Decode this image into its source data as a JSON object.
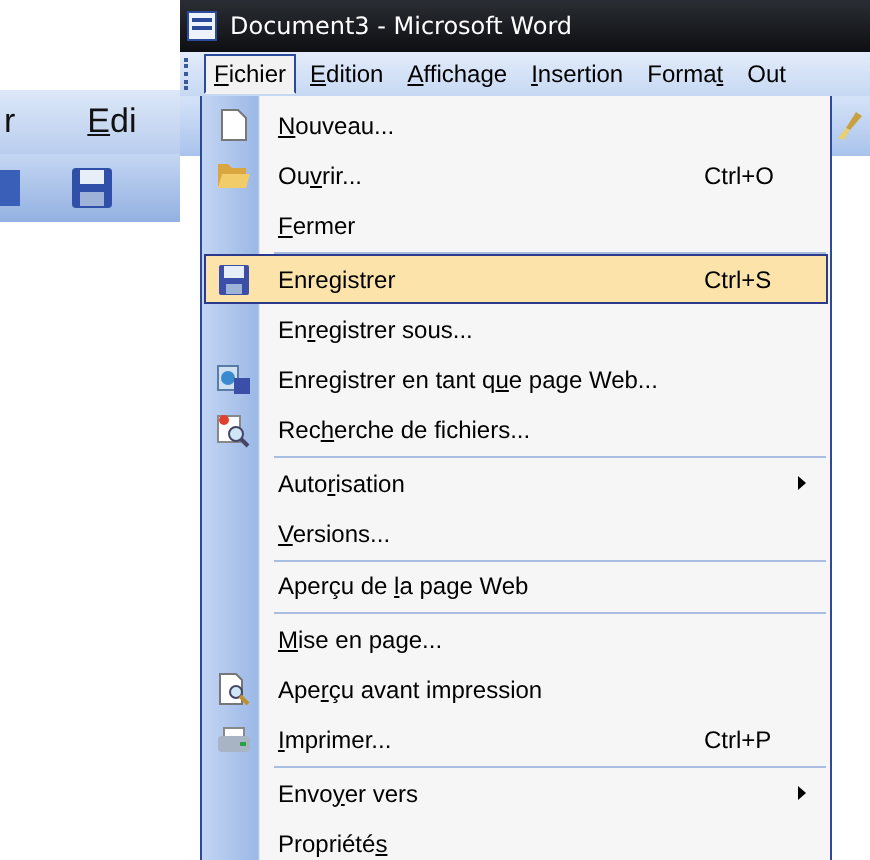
{
  "background_window": {
    "menu_items": [
      {
        "parts": [
          {
            "text": "r",
            "underline": false
          }
        ]
      },
      {
        "parts": [
          {
            "text": "E",
            "underline": true
          },
          {
            "text": "di",
            "underline": false
          }
        ]
      }
    ]
  },
  "window": {
    "title": "Document3 - Microsoft Word"
  },
  "menu_bar": [
    {
      "selected": true,
      "parts": [
        {
          "text": "F",
          "underline": true
        },
        {
          "text": "ichier",
          "underline": false
        }
      ]
    },
    {
      "selected": false,
      "parts": [
        {
          "text": "E",
          "underline": true
        },
        {
          "text": "dition",
          "underline": false
        }
      ]
    },
    {
      "selected": false,
      "parts": [
        {
          "text": "A",
          "underline": true
        },
        {
          "text": "ffichage",
          "underline": false
        }
      ]
    },
    {
      "selected": false,
      "parts": [
        {
          "text": "I",
          "underline": true
        },
        {
          "text": "nsertion",
          "underline": false
        }
      ]
    },
    {
      "selected": false,
      "parts": [
        {
          "text": "Forma",
          "underline": false
        },
        {
          "text": "t",
          "underline": true
        }
      ]
    },
    {
      "selected": false,
      "parts": [
        {
          "text": "Out",
          "underline": false
        }
      ]
    }
  ],
  "file_menu": [
    {
      "kind": "new",
      "selected": false,
      "separator_before": false,
      "submenu": false,
      "parts": [
        {
          "text": "N",
          "underline": true
        },
        {
          "text": "ouveau...",
          "underline": false
        }
      ]
    },
    {
      "kind": "open",
      "selected": false,
      "separator_before": false,
      "submenu": false,
      "shortcut": "Ctrl+O",
      "parts": [
        {
          "text": "Ou",
          "underline": false
        },
        {
          "text": "v",
          "underline": true
        },
        {
          "text": "rir...",
          "underline": false
        }
      ]
    },
    {
      "selected": false,
      "separator_before": false,
      "submenu": false,
      "parts": [
        {
          "text": "F",
          "underline": true
        },
        {
          "text": "ermer",
          "underline": false
        }
      ]
    },
    {
      "kind": "save",
      "selected": true,
      "separator_before": true,
      "submenu": false,
      "shortcut": "Ctrl+S",
      "parts": [
        {
          "text": "Enregistrer",
          "underline": false
        }
      ]
    },
    {
      "selected": false,
      "separator_before": false,
      "submenu": false,
      "parts": [
        {
          "text": "En",
          "underline": false
        },
        {
          "text": "r",
          "underline": true
        },
        {
          "text": "egistrer sous...",
          "underline": false
        }
      ]
    },
    {
      "kind": "web",
      "selected": false,
      "separator_before": false,
      "submenu": false,
      "parts": [
        {
          "text": "Enregistrer en tant q",
          "underline": false
        },
        {
          "text": "u",
          "underline": true
        },
        {
          "text": "e page Web...",
          "underline": false
        }
      ]
    },
    {
      "kind": "search",
      "selected": false,
      "separator_before": false,
      "submenu": false,
      "parts": [
        {
          "text": "Rec",
          "underline": false
        },
        {
          "text": "h",
          "underline": true
        },
        {
          "text": "erche de fichiers...",
          "underline": false
        }
      ]
    },
    {
      "selected": false,
      "separator_before": true,
      "submenu": true,
      "parts": [
        {
          "text": "Auto",
          "underline": false
        },
        {
          "text": "r",
          "underline": true
        },
        {
          "text": "isation",
          "underline": false
        }
      ]
    },
    {
      "selected": false,
      "separator_before": false,
      "submenu": false,
      "parts": [
        {
          "text": "V",
          "underline": true
        },
        {
          "text": "ersions...",
          "underline": false
        }
      ]
    },
    {
      "selected": false,
      "separator_before": true,
      "submenu": false,
      "parts": [
        {
          "text": "Aperçu de ",
          "underline": false
        },
        {
          "text": "l",
          "underline": true
        },
        {
          "text": "a page Web",
          "underline": false
        }
      ]
    },
    {
      "selected": false,
      "separator_before": true,
      "submenu": false,
      "parts": [
        {
          "text": "M",
          "underline": true
        },
        {
          "text": "ise en page...",
          "underline": false
        }
      ]
    },
    {
      "kind": "preview",
      "selected": false,
      "separator_before": false,
      "submenu": false,
      "parts": [
        {
          "text": "Ape",
          "underline": false
        },
        {
          "text": "r",
          "underline": true
        },
        {
          "text": "çu avant impression",
          "underline": false
        }
      ]
    },
    {
      "kind": "print",
      "selected": false,
      "separator_before": false,
      "submenu": false,
      "shortcut": "Ctrl+P",
      "parts": [
        {
          "text": "I",
          "underline": true
        },
        {
          "text": "mprimer...",
          "underline": false
        }
      ]
    },
    {
      "selected": false,
      "separator_before": true,
      "submenu": true,
      "parts": [
        {
          "text": "Envo",
          "underline": false
        },
        {
          "text": "y",
          "underline": true
        },
        {
          "text": "er vers",
          "underline": false
        }
      ]
    },
    {
      "selected": false,
      "separator_before": false,
      "submenu": false,
      "parts": [
        {
          "text": "Propriété",
          "underline": false
        },
        {
          "text": "s",
          "underline": true
        }
      ]
    }
  ]
}
